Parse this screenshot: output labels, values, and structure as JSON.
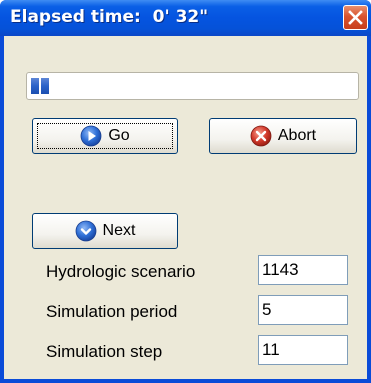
{
  "window": {
    "title": "Elapsed time:  0' 32\""
  },
  "progress": {
    "fraction": 0.03
  },
  "buttons": {
    "go": "Go",
    "abort": "Abort",
    "next": "Next"
  },
  "fields": [
    {
      "label": "Hydrologic scenario",
      "value": "1143"
    },
    {
      "label": "Simulation period",
      "value": "5"
    },
    {
      "label": "Simulation step",
      "value": "11"
    }
  ],
  "icons": {
    "go": "play-icon",
    "abort": "abort-icon",
    "next": "next-icon",
    "close": "close-icon"
  },
  "colors": {
    "titlebar": "#0554e0",
    "client": "#ece9d8",
    "progress_fill": "#2a62c8",
    "close_button": "#d9532f",
    "abort_icon": "#d33a2c",
    "go_icon": "#2f6fd6"
  }
}
